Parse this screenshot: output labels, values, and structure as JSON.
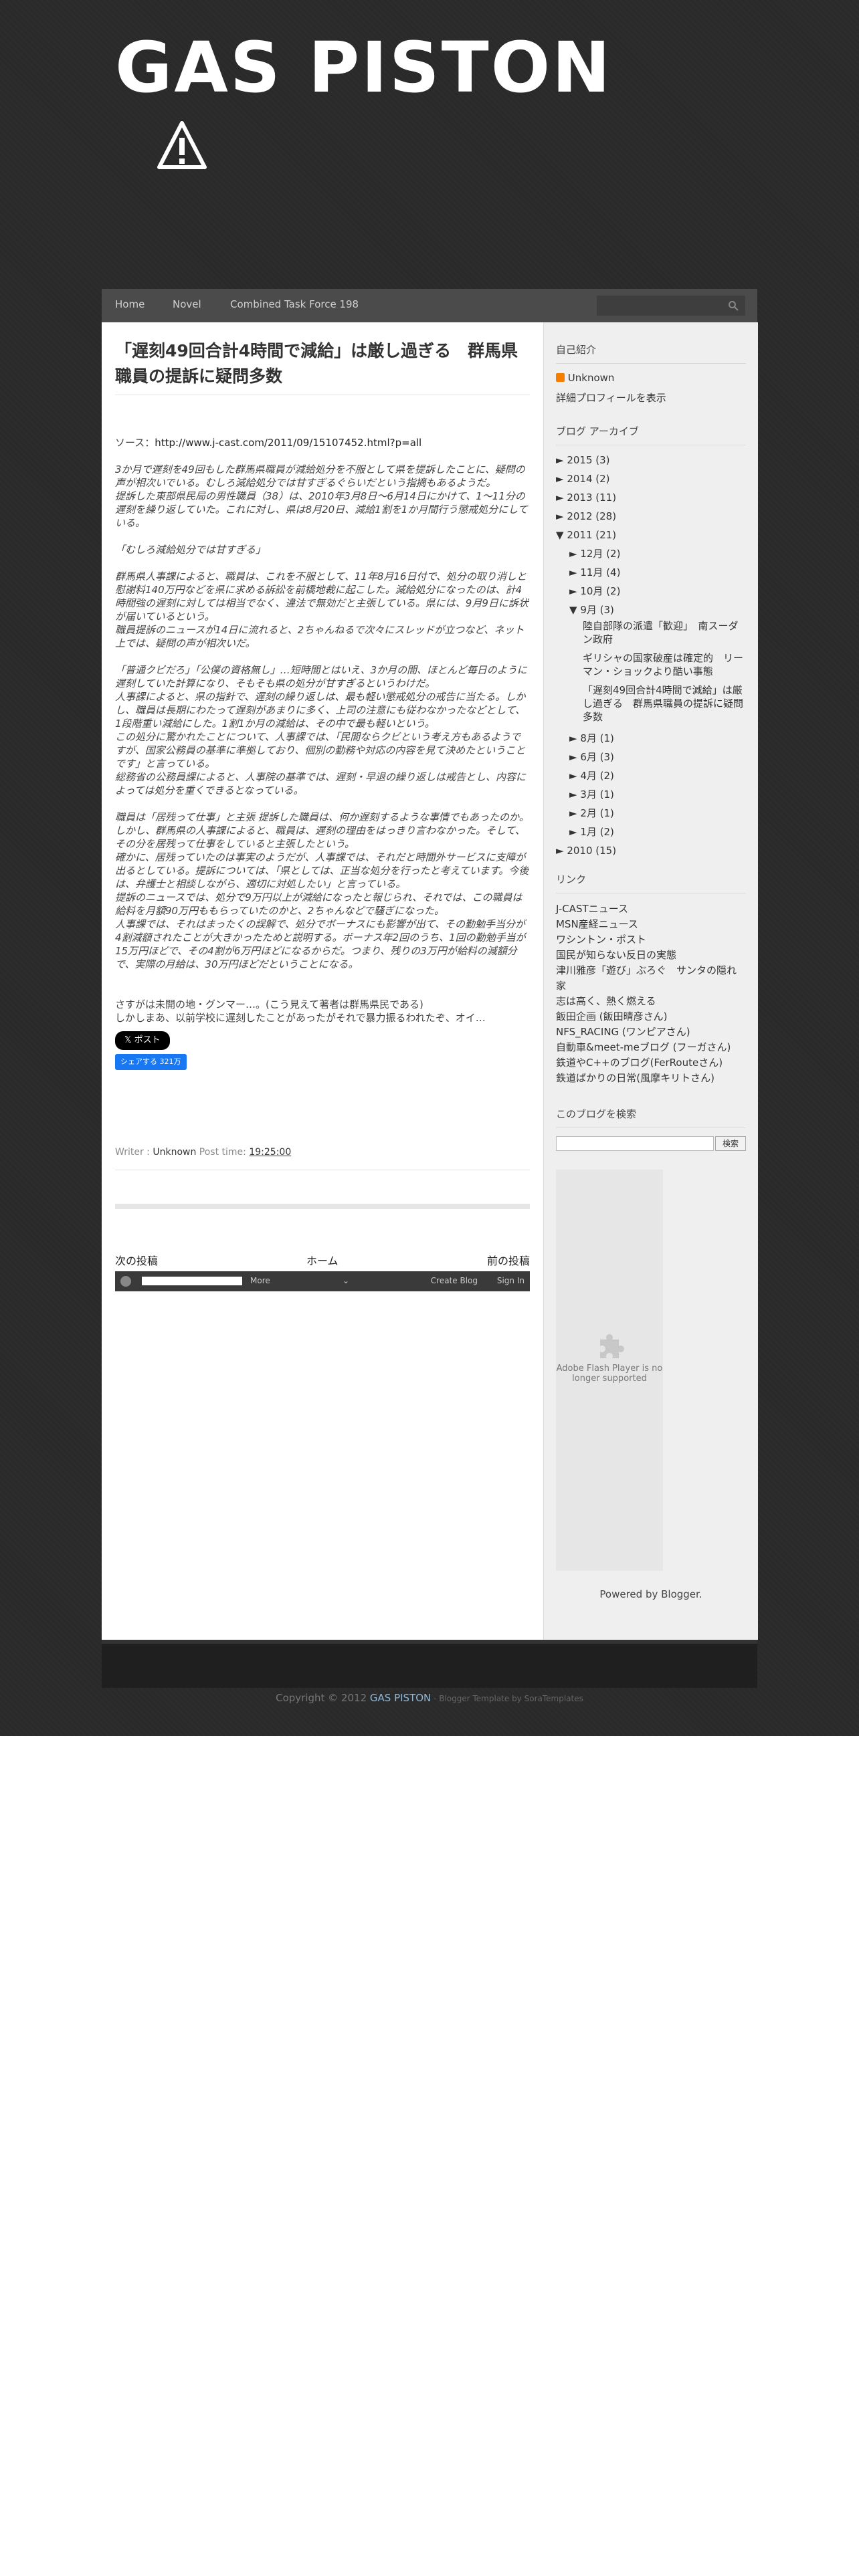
{
  "blog": {
    "title": "GAS PISTON"
  },
  "nav": {
    "home": "Home",
    "novel": "Novel",
    "ctf": "Combined Task Force 198"
  },
  "post": {
    "title": "「遅刻49回合計4時間で減給」は厳し過ぎる　群馬県職員の提訴に疑問多数",
    "source_label": "ソース：",
    "source_url": "http://www.j-cast.com/2011/09/15107452.html?p=all",
    "p1": "3か月で遅刻を49回もした群馬県職員が減給処分を不服として県を提訴したことに、疑問の声が相次いでいる。むしろ減給処分では甘すぎるぐらいだという指摘もあるようだ。",
    "p1b": "提訴した東部県民局の男性職員（38）は、2010年3月8日〜6月14日にかけて、1〜11分の遅刻を繰り返していた。これに対し、県は8月20日、減給1割を1か月間行う懲戒処分にしている。",
    "p2": "「むしろ減給処分では甘すぎる」",
    "p3": "群馬県人事課によると、職員は、これを不服として、11年8月16日付で、処分の取り消しと慰謝料140万円などを県に求める訴訟を前橋地裁に起こした。減給処分になったのは、計4時間強の遅刻に対しては相当でなく、違法で無効だと主張している。県には、9月9日に訴状が届いているという。",
    "p3b": "職員提訴のニュースが14日に流れると、2ちゃんねるで次々にスレッドが立つなど、ネット上では、疑問の声が相次いだ。",
    "p4": "「普通クビだろ」「公僕の資格無し」…短時間とはいえ、3か月の間、ほとんど毎日のように遅刻していた計算になり、そもそも県の処分が甘すぎるというわけだ。",
    "p4b": "人事課によると、県の指針で、遅刻の繰り返しは、最も軽い懲戒処分の戒告に当たる。しかし、職員は長期にわたって遅刻があまりに多く、上司の注意にも従わなかったなどとして、1段階重い減給にした。1割1か月の減給は、その中で最も軽いという。",
    "p4c": "この処分に驚かれたことについて、人事課では、「民間ならクビという考え方もあるようですが、国家公務員の基準に準拠しており、個別の勤務や対応の内容を見て決めたということです」と言っている。",
    "p4d": "総務省の公務員課によると、人事院の基準では、遅刻・早退の繰り返しは戒告とし、内容によっては処分を重くできるとなっている。",
    "p5": "職員は「居残って仕事」と主張 提訴した職員は、何か遅刻するような事情でもあったのか。",
    "p5b": "しかし、群馬県の人事課によると、職員は、遅刻の理由をはっきり言わなかった。そして、その分を居残って仕事をしていると主張したという。",
    "p5c": "確かに、居残っていたのは事実のようだが、人事課では、それだと時間外サービスに支障が出るとしている。提訴については、「県としては、正当な処分を行ったと考えています。今後は、弁護士と相談しながら、適切に対処したい」と言っている。",
    "p5d": "提訴のニュースでは、処分で9万円以上が減給になったと報じられ、それでは、この職員は給料を月額90万円ももらっていたのかと、2ちゃんなどで騒ぎになった。",
    "p5e": "人事課では、それはまったくの誤解で、処分でボーナスにも影響が出て、その勤勉手当分が4割減額されたことが大きかったためと説明する。ボーナス年2回のうち、1回の勤勉手当が15万円ほどで、その4割が6万円ほどになるからだ。つまり、残りの3万円が給料の減額分で、実際の月給は、30万円ほどだということになる。",
    "p6": "さすがは未開の地・グンマー…。(こう見えて著者は群馬県民である)",
    "p6b": "しかしまあ、以前学校に遅刻したことがあったがそれで暴力振るわれたぞ、オイ…",
    "btn_x": "ポスト",
    "btn_fb": "シェアする 321万",
    "meta_writer_label": "Writer : ",
    "meta_writer": "Unknown",
    "meta_time_label": " Post time: ",
    "meta_time": "19:25:00"
  },
  "pager": {
    "newer": "次の投稿",
    "home": "ホーム",
    "older": "前の投稿"
  },
  "bloggerbar": {
    "more": "More",
    "create": "Create Blog",
    "signin": "Sign In"
  },
  "sidebar": {
    "profile_h": "自己紹介",
    "profile_name": "Unknown",
    "profile_link": "詳細プロフィールを表示",
    "archive_h": "ブログ アーカイブ",
    "archive": [
      {
        "t": "► ",
        "label": "2015",
        "count": " (3)",
        "indent": 0
      },
      {
        "t": "► ",
        "label": "2014",
        "count": " (2)",
        "indent": 0
      },
      {
        "t": "► ",
        "label": "2013",
        "count": " (11)",
        "indent": 0
      },
      {
        "t": "► ",
        "label": "2012",
        "count": " (28)",
        "indent": 0
      },
      {
        "t": "▼ ",
        "label": "2011",
        "count": " (21)",
        "indent": 0
      },
      {
        "t": "► ",
        "label": "12月",
        "count": " (2)",
        "indent": 1
      },
      {
        "t": "► ",
        "label": "11月",
        "count": " (4)",
        "indent": 1
      },
      {
        "t": "► ",
        "label": "10月",
        "count": " (2)",
        "indent": 1
      },
      {
        "t": "▼ ",
        "label": "9月",
        "count": " (3)",
        "indent": 1
      }
    ],
    "sept_posts": [
      "陸自部隊の派遣「歓迎」　南スーダン政府",
      "ギリシャの国家破産は確定的　リーマン・ショックより酷い事態",
      "「遅刻49回合計4時間で減給」は厳し過ぎる　群馬県職員の提訴に疑問多数"
    ],
    "archive2": [
      {
        "t": "► ",
        "label": "8月",
        "count": " (1)",
        "indent": 1
      },
      {
        "t": "► ",
        "label": "6月",
        "count": " (3)",
        "indent": 1
      },
      {
        "t": "► ",
        "label": "4月",
        "count": " (2)",
        "indent": 1
      },
      {
        "t": "► ",
        "label": "3月",
        "count": " (1)",
        "indent": 1
      },
      {
        "t": "► ",
        "label": "2月",
        "count": " (1)",
        "indent": 1
      },
      {
        "t": "► ",
        "label": "1月",
        "count": " (2)",
        "indent": 1
      },
      {
        "t": "► ",
        "label": "2010",
        "count": " (15)",
        "indent": 0
      }
    ],
    "links_h": "リンク",
    "links": [
      "J-CASTニュース",
      "MSN産経ニュース",
      "ワシントン・ポスト",
      "国民が知らない反日の実態",
      "津川雅彦「遊び」ぶろぐ　サンタの隠れ家",
      "志は高く、熱く燃える",
      "飯田企画 (飯田晴彦さん)",
      "NFS_RACING (ワンピアさん)",
      "自動車&meet-meブログ (フーガさん)",
      "鉄道やC++のブログ(FerRouteさん)",
      "鉄道ばかりの日常(風摩キリトさん)"
    ],
    "search_h": "このブログを検索",
    "search_btn": "検索",
    "flash_text": "Adobe Flash Player is no longer supported",
    "powered": "Powered by Blogger."
  },
  "footer": {
    "copyright": "Copyright © 2012 ",
    "blogname": "GAS PISTON",
    "template": " - Blogger Template by ",
    "vendor": "SoraTemplates"
  }
}
